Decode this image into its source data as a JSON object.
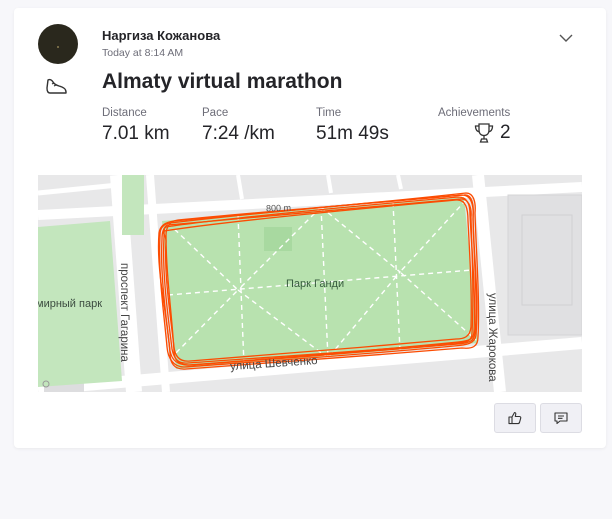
{
  "athlete": {
    "name": "Наргиза Кожанова",
    "timestamp": "Today at 8:14 AM"
  },
  "activity": {
    "type_icon": "run-shoe-icon",
    "title": "Almaty virtual marathon"
  },
  "stats": [
    {
      "label": "Distance",
      "value": "7.01 km"
    },
    {
      "label": "Pace",
      "value": "7:24 /km"
    },
    {
      "label": "Time",
      "value": "51m 49s"
    },
    {
      "label": "Achievements",
      "value": "2",
      "icon": "trophy-icon"
    }
  ],
  "map": {
    "park_name": "Парк Ганди",
    "park_left": "мирный парк",
    "street_gagarin": "проспект Гагарина",
    "street_shevchenko": "улица Шевченко",
    "street_zharokov": "улица Жарокова",
    "scale": "800 m",
    "colors": {
      "park": "#b9e3b1",
      "road": "#ffffff",
      "route": "#fc4c02"
    }
  },
  "actions": {
    "kudos_icon": "thumbs-up-icon",
    "comment_icon": "comment-icon"
  }
}
